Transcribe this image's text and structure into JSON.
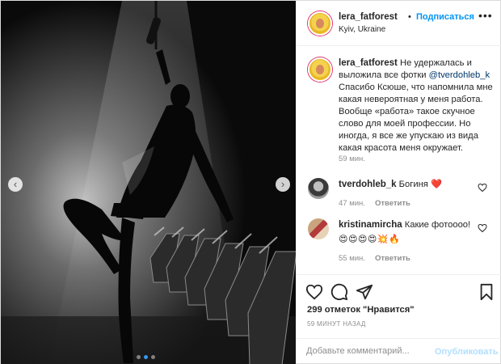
{
  "post": {
    "author": "lera_fatforest",
    "follow_label": "Подписаться",
    "separator": "•",
    "location": "Kyiv, Ukraine",
    "more_icon": "more-horizontal-icon"
  },
  "photo": {
    "prev_icon": "chevron-left-icon",
    "next_icon": "chevron-right-icon",
    "prev_glyph": "‹",
    "next_glyph": "›",
    "slide_count": 3,
    "active_slide": 1
  },
  "caption": {
    "username": "lera_fatforest",
    "text_before": " Не удержалась и выложила все фотки ",
    "mention": "@tverdohleb_k",
    "text_after": " Спасибо Ксюше, что напомнила мне какая невероятная у меня работа. Вообще «работа» такое скучное слово для моей профессии. Но иногда, я все же упускаю из вида какая красота меня окружает.",
    "time": "59 мин."
  },
  "comments": [
    {
      "username": "tverdohleb_k",
      "text": " Богиня ",
      "emoji": "❤️",
      "time": "47 мин.",
      "reply_label": "Ответить"
    },
    {
      "username": "kristinamircha",
      "text": " Какие фотоооо!",
      "emoji": "😍😍😍😍💥🔥",
      "time": "55 мин.",
      "reply_label": "Ответить"
    }
  ],
  "actions": {
    "like_icon": "heart-icon",
    "comment_icon": "comment-icon",
    "share_icon": "share-icon",
    "save_icon": "bookmark-icon"
  },
  "likes_text": "299 отметок \"Нравится\"",
  "posted_text": "59 МИНУТ НАЗАД",
  "add_comment": {
    "placeholder": "Добавьте комментарий...",
    "publish_label": "Опубликовать"
  },
  "colors": {
    "link_blue": "#0095f6",
    "publish_disabled": "#b2dffc",
    "heart_red": "#ed4956"
  }
}
